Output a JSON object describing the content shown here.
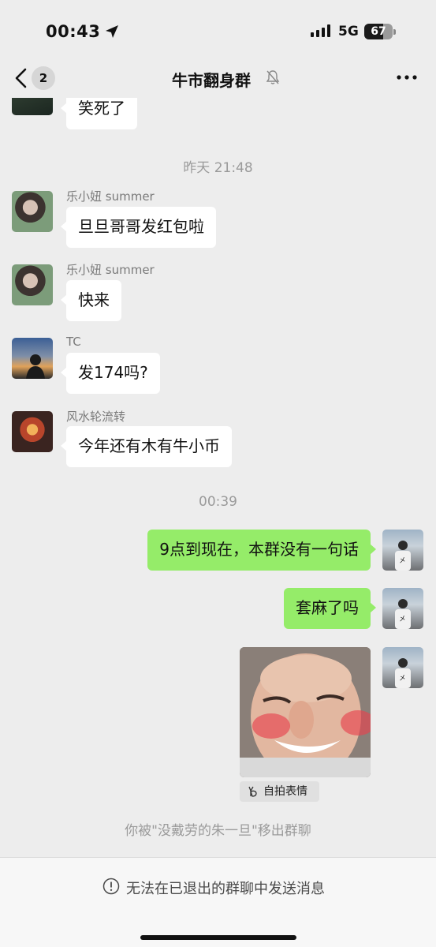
{
  "status_bar": {
    "time": "00:43",
    "network": "5G",
    "battery": "67"
  },
  "nav": {
    "back_count": "2",
    "title": "牛市翻身群"
  },
  "messages": [
    {
      "text": "笑死了"
    },
    {
      "timestamp": "昨天 21:48"
    },
    {
      "sender": "乐小妞 summer",
      "text": "旦旦哥哥发红包啦"
    },
    {
      "sender": "乐小妞 summer",
      "text": "快来"
    },
    {
      "sender": "TC",
      "text": "发174吗?"
    },
    {
      "sender": "风水轮流转",
      "text": "今年还有木有牛小币"
    },
    {
      "timestamp": "00:39"
    },
    {
      "text": "9点到现在，本群没有一句话"
    },
    {
      "text": "套麻了吗"
    },
    {
      "sticker_label": "自拍表情"
    }
  ],
  "system_message": "你被\"没戴劳的朱一旦\"移出群聊",
  "bottom_bar": {
    "notice": "无法在已退出的群聊中发送消息"
  },
  "colors": {
    "background": "#ededed",
    "bubble_right": "#95ec69",
    "bubble_left": "#ffffff",
    "muted_text": "#9a9a9a"
  },
  "icons": [
    "location-arrow-icon",
    "signal-icon",
    "battery-icon",
    "back-chevron-icon",
    "mute-bell-icon",
    "more-dots-icon",
    "peace-hand-icon",
    "info-circle-icon"
  ]
}
